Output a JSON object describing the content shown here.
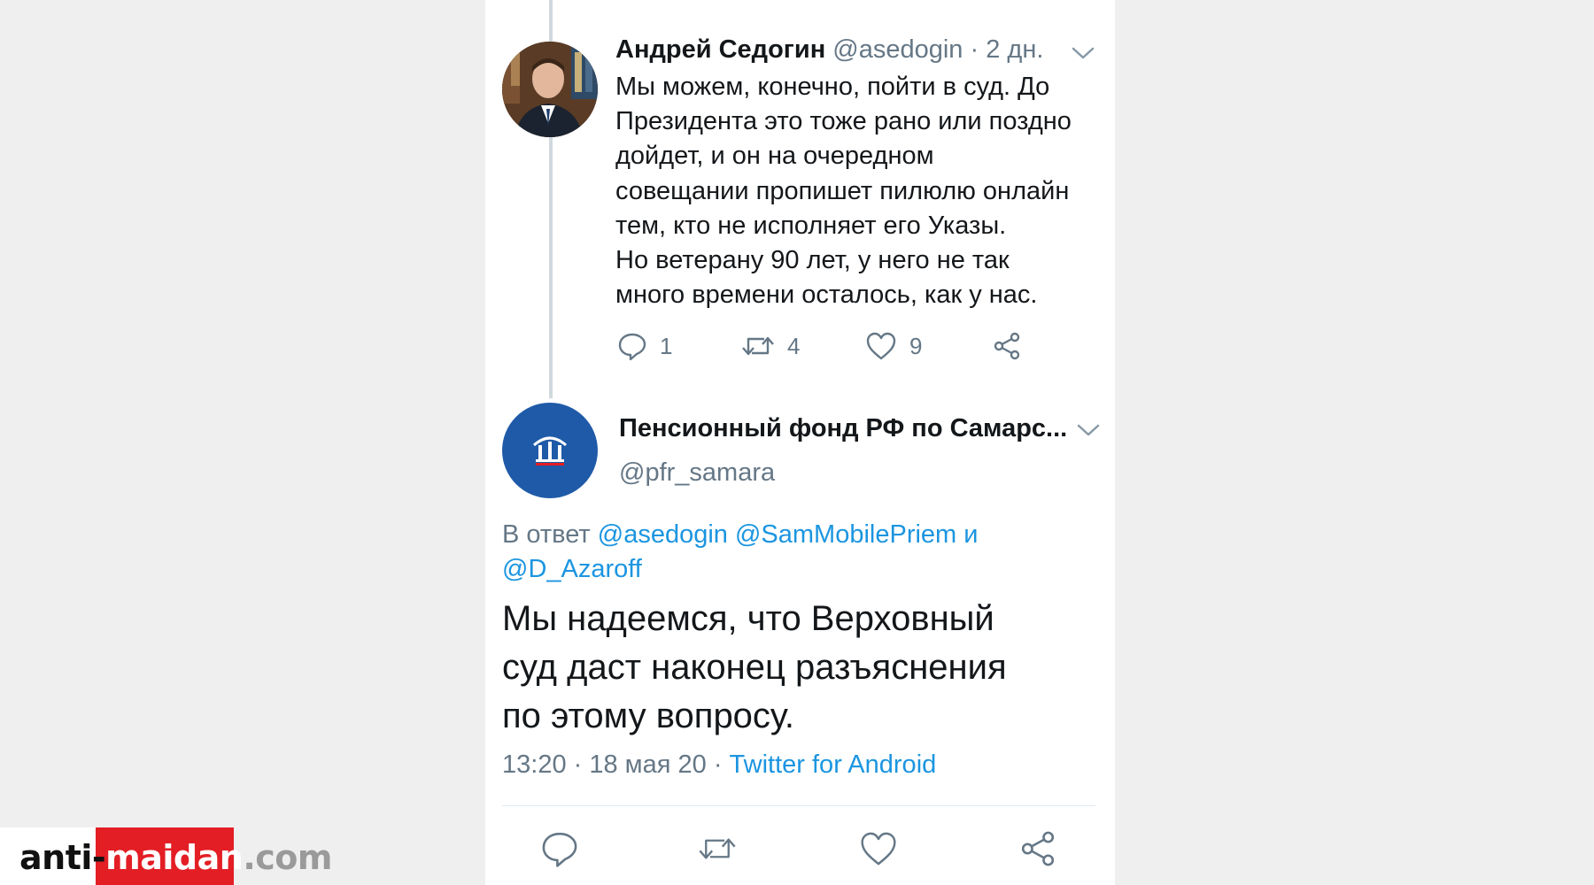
{
  "tweet1": {
    "author_name": "Андрей Седогин",
    "handle": "@asedogin",
    "separator": " · ",
    "time_ago": "2 дн.",
    "text_lines": [
      "Мы можем, конечно, пойти в суд. До",
      "Президента это тоже рано или поздно",
      "дойдет, и он на очередном",
      "совещании пропишет пилюлю онлайн",
      "тем, кто не исполняет его Указы.",
      "Но ветерану 90 лет, у него не так",
      "много времени осталось, как у нас."
    ],
    "actions": {
      "replies": "1",
      "retweets": "4",
      "likes": "9"
    }
  },
  "tweet2": {
    "author_name": "Пенсионный фонд РФ по Самарс...",
    "handle": "@pfr_samara",
    "reply_prefix": "В ответ ",
    "reply_mention_1": "@asedogin",
    "reply_mention_2": "@SamMobilePriem",
    "reply_and": "и",
    "reply_mention_3": "@D_Azaroff",
    "text_lines": [
      "Мы надеемся, что Верховный",
      "суд даст наконец разъяснения",
      "по этому вопросу."
    ],
    "time": "13:20",
    "separator": " · ",
    "date": "18 мая 20",
    "source": "Twitter for Android"
  },
  "watermark": {
    "part1": "anti-",
    "part2": "maidan",
    "part3": ".com"
  },
  "icons": {
    "reply": "speech-bubble-icon",
    "retweet": "retweet-arrows-icon",
    "like": "heart-icon",
    "share": "share-nodes-icon",
    "menu": "chevron-down-icon"
  },
  "colors": {
    "link": "#1b95e0",
    "muted": "#657786",
    "text": "#14171a",
    "logo_red": "#e31e24",
    "pfr_blue": "#1f5aa8"
  }
}
